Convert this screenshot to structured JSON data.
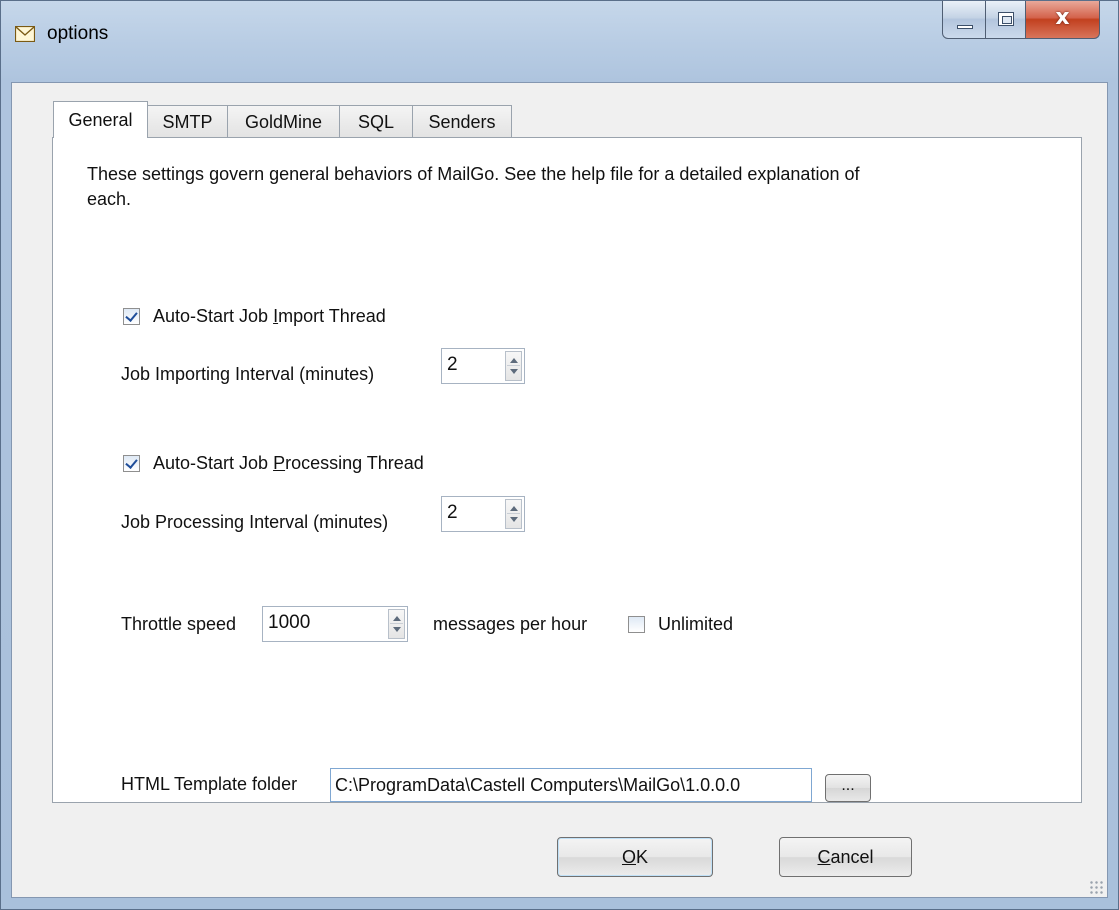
{
  "window": {
    "title": "options",
    "icon": "envelope-icon"
  },
  "tabs": [
    {
      "label": "General",
      "active": true
    },
    {
      "label": "SMTP",
      "active": false
    },
    {
      "label": "GoldMine",
      "active": false
    },
    {
      "label": "SQL",
      "active": false
    },
    {
      "label": "Senders",
      "active": false
    }
  ],
  "general": {
    "description": "These settings govern general behaviors of MailGo.  See the help file for a detailed explanation of each.",
    "import_thread": {
      "checkbox_pre": "Auto-Start Job ",
      "checkbox_mnemonic": "I",
      "checkbox_post": "mport Thread",
      "checked": true,
      "interval_label": "Job Importing Interval (minutes)",
      "interval_value": "2"
    },
    "processing_thread": {
      "checkbox_pre": "Auto-Start Job ",
      "checkbox_mnemonic": "P",
      "checkbox_post": "rocessing Thread",
      "checked": true,
      "interval_label": "Job Processing Interval (minutes)",
      "interval_value": "2"
    },
    "throttle": {
      "label": "Throttle speed",
      "value": "1000",
      "unit_label": "messages per hour",
      "unlimited_label": "Unlimited",
      "unlimited_checked": false
    },
    "template": {
      "label": "HTML Template folder",
      "value": "C:\\ProgramData\\Castell Computers\\MailGo\\1.0.0.0",
      "browse_label": "..."
    }
  },
  "buttons": {
    "ok_mnemonic": "O",
    "ok_rest": "K",
    "cancel_mnemonic": "C",
    "cancel_rest": "ancel"
  },
  "colors": {
    "titlebar": "#b9cde4",
    "close_button": "#c2401f",
    "dialog_bg": "#f0f0f0",
    "focus_border": "#7fa7d2"
  }
}
